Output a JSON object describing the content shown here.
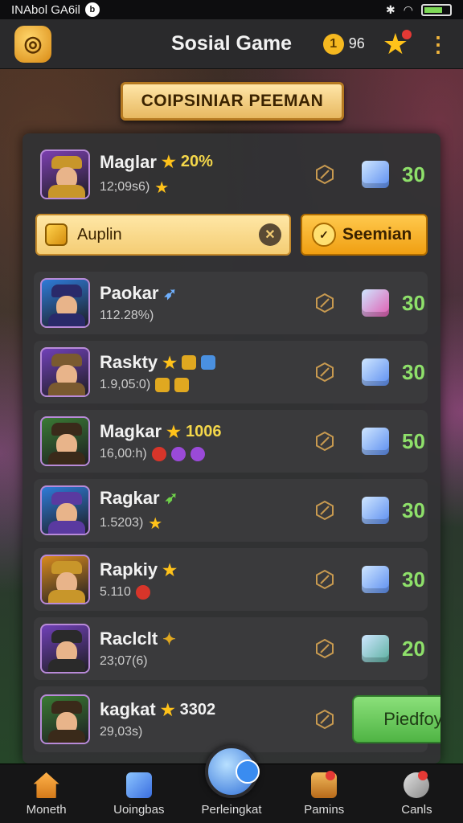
{
  "status_bar": {
    "carrier": "INAbol GA6il",
    "carrier_badge": "b"
  },
  "header": {
    "title": "Sosial Game",
    "coin_symbol": "1",
    "coin_count": "96",
    "menu_icon": "kebab-menu-icon"
  },
  "banner": {
    "text": "COIPSINIAR PEEMAN"
  },
  "search": {
    "value": "Auplin"
  },
  "seemian_button": {
    "label": "Seemian"
  },
  "rows": [
    {
      "name": "Maglar",
      "sub": "12;09s6)",
      "extra": "20%",
      "count": "30",
      "avatar": "#7b3fb0",
      "hat": "#c8962a",
      "cube": "#5b8df0"
    },
    {
      "name": "Paokar",
      "sub": "112.28%)",
      "extra": "",
      "count": "30",
      "avatar": "#2e7bd8",
      "hat": "#2a2a6a",
      "cube": "#e05bb0"
    },
    {
      "name": "Raskty",
      "sub": "1.9,05:0)",
      "extra": "",
      "count": "30",
      "avatar": "#7040b8",
      "hat": "#7a5a30",
      "cube": "#5b8df0"
    },
    {
      "name": "Magkar",
      "sub": "16,00:h)",
      "extra": "1006",
      "count": "50",
      "avatar": "#3a7a34",
      "hat": "#3a2a1a",
      "cube": "#5b8df0"
    },
    {
      "name": "Ragkar",
      "sub": "1.5203)",
      "extra": "",
      "count": "30",
      "avatar": "#2e7bd8",
      "hat": "#5a3aa0",
      "cube": "#5b8df0"
    },
    {
      "name": "Rapkiy",
      "sub": "5.110",
      "extra": "",
      "count": "30",
      "avatar": "#d88a20",
      "hat": "#c8962a",
      "cube": "#5b8df0"
    },
    {
      "name": "Raclclt",
      "sub": "23;07(6)",
      "extra": "",
      "count": "20",
      "avatar": "#7040b8",
      "hat": "#2a2a2a",
      "cube": "#5bb0a0"
    },
    {
      "name": "kagkat",
      "sub": "29,03s)",
      "extra": "3302",
      "count": "",
      "avatar": "#3a7a34",
      "hat": "#3a2a1a",
      "cube": ""
    }
  ],
  "play_button": {
    "label": "Piedfoy"
  },
  "nav": [
    {
      "label": "Moneth",
      "icon": "home-icon"
    },
    {
      "label": "Uoingbas",
      "icon": "cube-icon"
    },
    {
      "label": "Perleingkat",
      "icon": "orb-icon"
    },
    {
      "label": "Pamins",
      "icon": "mailbox-icon"
    },
    {
      "label": "Canls",
      "icon": "wrench-icon"
    }
  ]
}
